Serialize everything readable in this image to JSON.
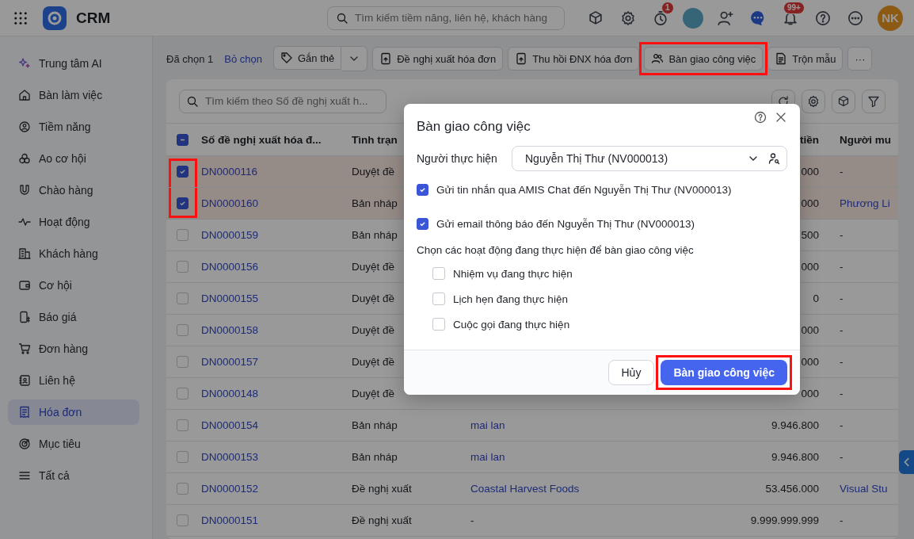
{
  "topbar": {
    "app_name": "CRM",
    "search_placeholder": "Tìm kiếm tiềm năng, liên hệ, khách hàng",
    "timer_badge": "1",
    "bell_badge": "99+",
    "user_initials": "NK"
  },
  "sidebar": {
    "items": [
      {
        "label": "Trung tâm AI",
        "selected": false
      },
      {
        "label": "Bàn làm việc",
        "selected": false
      },
      {
        "label": "Tiềm năng",
        "selected": false
      },
      {
        "label": "Ao cơ hội",
        "selected": false
      },
      {
        "label": "Chào hàng",
        "selected": false
      },
      {
        "label": "Hoạt động",
        "selected": false
      },
      {
        "label": "Khách hàng",
        "selected": false
      },
      {
        "label": "Cơ hội",
        "selected": false
      },
      {
        "label": "Báo giá",
        "selected": false
      },
      {
        "label": "Đơn hàng",
        "selected": false
      },
      {
        "label": "Liên hệ",
        "selected": false
      },
      {
        "label": "Hóa đơn",
        "selected": true
      },
      {
        "label": "Mục tiêu",
        "selected": false
      },
      {
        "label": "Tất cả",
        "selected": false
      }
    ]
  },
  "toolbar": {
    "selected_count": "Đã chọn 1",
    "deselect": "Bỏ chọn",
    "actions": [
      {
        "label": "Gắn thẻ",
        "dropdown": true,
        "highlighted": false
      },
      {
        "label": "Đề nghị xuất hóa đơn",
        "dropdown": false,
        "highlighted": false
      },
      {
        "label": "Thu hồi ĐNX hóa đơn",
        "dropdown": false,
        "highlighted": false
      },
      {
        "label": "Bàn giao công việc",
        "dropdown": false,
        "highlighted": true
      },
      {
        "label": "Trộn mẫu",
        "dropdown": false,
        "highlighted": false
      }
    ],
    "more": "···"
  },
  "table": {
    "search_placeholder": "Tìm kiếm theo Số đề nghị xuất h...",
    "select_all": {
      "indeterminate": true
    },
    "columns": [
      {
        "label": "Số đề nghị xuất hóa đ..."
      },
      {
        "label": "Tình trạn"
      },
      {},
      {
        "label": "tiền"
      },
      {
        "label": "Người mu"
      }
    ],
    "rows": [
      {
        "number": "DN0000116",
        "status": "Duyệt đề",
        "amount": "000",
        "buyer": "-",
        "selected": true,
        "highlighted": true
      },
      {
        "number": "DN0000160",
        "status": "Bản nháp",
        "amount": "000",
        "buyer": "Phương Li",
        "selected": true,
        "highlighted": true
      },
      {
        "number": "DN0000159",
        "status": "Bản nháp",
        "amount": "500",
        "buyer": "-",
        "selected": false,
        "highlighted": false
      },
      {
        "number": "DN0000156",
        "status": "Duyệt đề",
        "amount": "000",
        "buyer": "-",
        "selected": false,
        "highlighted": false
      },
      {
        "number": "DN0000155",
        "status": "Duyệt đề",
        "amount": "0",
        "buyer": "-",
        "selected": false,
        "highlighted": false
      },
      {
        "number": "DN0000158",
        "status": "Duyệt đề",
        "amount": "000",
        "buyer": "-",
        "selected": false,
        "highlighted": false
      },
      {
        "number": "DN0000157",
        "status": "Duyệt đề",
        "amount": "000",
        "buyer": "-",
        "selected": false,
        "highlighted": false
      },
      {
        "number": "DN0000148",
        "status": "Duyệt đề",
        "amount": "000",
        "buyer": "-",
        "selected": false,
        "highlighted": false
      },
      {
        "number": "DN0000154",
        "status": "Bản nháp",
        "customer": "mai lan",
        "amount": "9.946.800",
        "buyer": "-",
        "selected": false,
        "highlighted": false
      },
      {
        "number": "DN0000153",
        "status": "Bản nháp",
        "customer": "mai lan",
        "amount": "9.946.800",
        "buyer": "-",
        "selected": false,
        "highlighted": false
      },
      {
        "number": "DN0000152",
        "status": "Đề nghị xuất",
        "customer": "Coastal Harvest Foods",
        "amount": "53.456.000",
        "buyer": "Visual Stu",
        "selected": false,
        "highlighted": false
      },
      {
        "number": "DN0000151",
        "status": "Đề nghị xuất",
        "customer": "-",
        "amount": "9.999.999.999",
        "buyer": "-",
        "selected": false,
        "highlighted": false
      }
    ]
  },
  "dialog": {
    "title": "Bàn giao công việc",
    "assignee_label": "Người thực hiện",
    "assignee_value": "Nguyễn Thị Thư (NV000013)",
    "notify_options": [
      {
        "label": "Gửi tin nhắn qua AMIS Chat đến Nguyễn Thị Thư (NV000013)",
        "checked": true
      },
      {
        "label": "Gửi email thông báo đến Nguyễn Thị Thư (NV000013)",
        "checked": true
      }
    ],
    "activities_label": "Chọn các hoạt động đang thực hiện để bàn giao công việc",
    "activities": [
      {
        "label": "Nhiệm vụ đang thực hiện",
        "checked": false
      },
      {
        "label": "Lịch hẹn đang thực hiện",
        "checked": false
      },
      {
        "label": "Cuộc gọi đang thực hiện",
        "checked": false
      }
    ],
    "cancel": "Hủy",
    "confirm": {
      "label": "Bàn giao công việc",
      "highlighted": true
    }
  }
}
